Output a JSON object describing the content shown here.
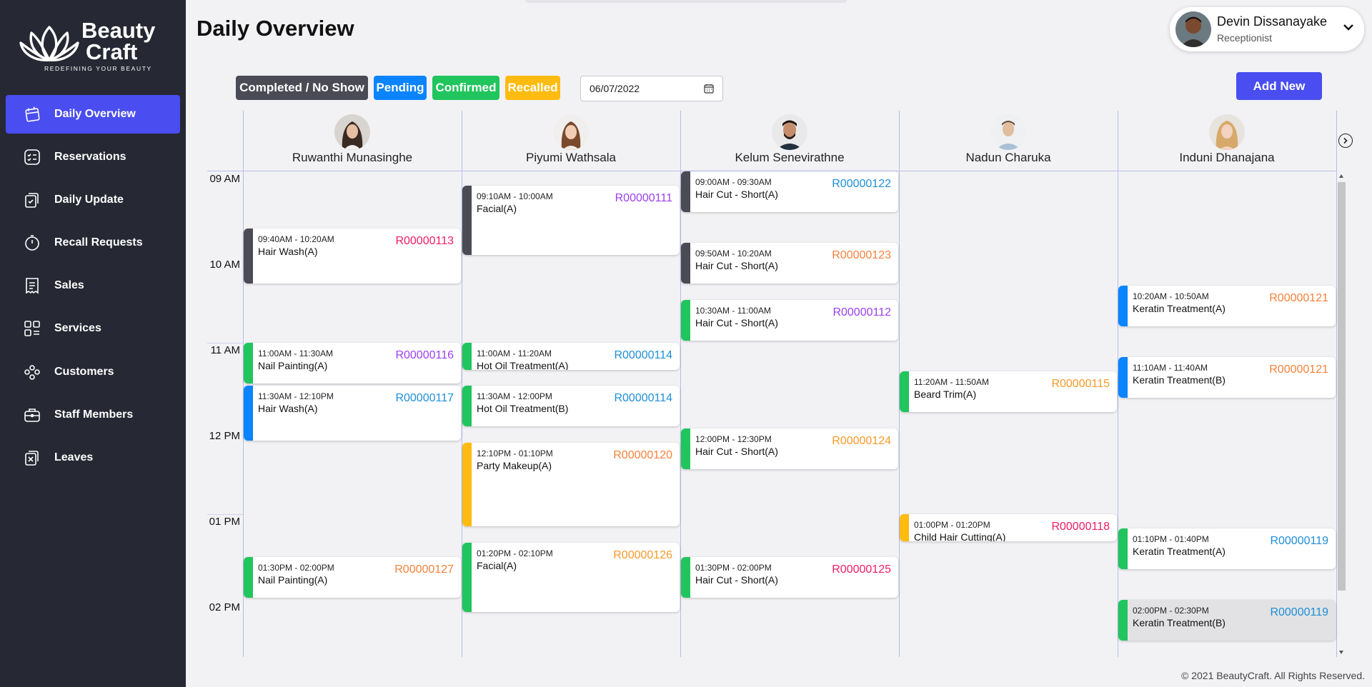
{
  "brand": {
    "name_line1": "Beauty",
    "name_line2": "Craft",
    "tagline": "REDEFINING YOUR BEAUTY"
  },
  "sidebar": {
    "items": [
      {
        "label": "Daily Overview",
        "icon": "calendar-icon",
        "active": true
      },
      {
        "label": "Reservations",
        "icon": "checklist-icon"
      },
      {
        "label": "Daily Update",
        "icon": "daily-update-icon"
      },
      {
        "label": "Recall Requests",
        "icon": "timer-icon"
      },
      {
        "label": "Sales",
        "icon": "receipt-icon"
      },
      {
        "label": "Services",
        "icon": "services-grid-icon"
      },
      {
        "label": "Customers",
        "icon": "customers-icon"
      },
      {
        "label": "Staff Members",
        "icon": "briefcase-icon"
      },
      {
        "label": "Leaves",
        "icon": "leave-icon"
      }
    ]
  },
  "header": {
    "title": "Daily Overview",
    "user": {
      "name": "Devin Dissanayake",
      "role": "Receptionist"
    }
  },
  "legend": [
    {
      "label": "Completed / No Show",
      "color": "#4a4b55"
    },
    {
      "label": "Pending",
      "color": "#0a84ff"
    },
    {
      "label": "Confirmed",
      "color": "#21c55d"
    },
    {
      "label": "Recalled",
      "color": "#ffbb0f"
    }
  ],
  "filters": {
    "date": "06/07/2022"
  },
  "actions": {
    "add_new": "Add New"
  },
  "calendar": {
    "staff": [
      {
        "name": "Ruwanthi Munasinghe"
      },
      {
        "name": "Piyumi Wathsala"
      },
      {
        "name": "Kelum Senevirathne"
      },
      {
        "name": "Nadun Charuka"
      },
      {
        "name": "Induni Dhanajana"
      }
    ],
    "hours": [
      "09 AM",
      "10 AM",
      "11 AM",
      "12 PM",
      "01 PM",
      "02 PM"
    ],
    "appointments": [
      {
        "staff": 0,
        "time": "09:40AM - 10:20AM",
        "service": "Hair Wash(A)",
        "code": "R00000113",
        "status": "completed",
        "code_color": "#ee1d62",
        "start_min": 40,
        "end_min": 80
      },
      {
        "staff": 0,
        "time": "11:00AM - 11:30AM",
        "service": "Nail Painting(A)",
        "code": "R00000116",
        "status": "confirmed",
        "code_color": "#9b3ff0",
        "start_min": 120,
        "end_min": 150
      },
      {
        "staff": 0,
        "time": "11:30AM - 12:10PM",
        "service": "Hair Wash(A)",
        "code": "R00000117",
        "status": "pending",
        "code_color": "#1e8fd6",
        "start_min": 150,
        "end_min": 190
      },
      {
        "staff": 0,
        "time": "01:30PM - 02:00PM",
        "service": "Nail Painting(A)",
        "code": "R00000127",
        "status": "confirmed",
        "code_color": "#f5823c",
        "start_min": 270,
        "end_min": 300
      },
      {
        "staff": 1,
        "time": "09:10AM - 10:00AM",
        "service": "Facial(A)",
        "code": "R00000111",
        "status": "completed",
        "code_color": "#9b3ff0",
        "start_min": 10,
        "end_min": 60
      },
      {
        "staff": 1,
        "time": "11:00AM - 11:20AM",
        "service": "Hot Oil Treatment(A)",
        "code": "R00000114",
        "status": "confirmed",
        "code_color": "#1e8fd6",
        "start_min": 120,
        "end_min": 140
      },
      {
        "staff": 1,
        "time": "11:30AM - 12:00PM",
        "service": "Hot Oil Treatment(B)",
        "code": "R00000114",
        "status": "confirmed",
        "code_color": "#1e8fd6",
        "start_min": 150,
        "end_min": 180
      },
      {
        "staff": 1,
        "time": "12:10PM - 01:10PM",
        "service": "Party Makeup(A)",
        "code": "R00000120",
        "status": "recalled",
        "code_color": "#f5823c",
        "start_min": 190,
        "end_min": 250
      },
      {
        "staff": 1,
        "time": "01:20PM - 02:10PM",
        "service": "Facial(A)",
        "code": "R00000126",
        "status": "confirmed",
        "code_color": "#f59a2a",
        "start_min": 260,
        "end_min": 310
      },
      {
        "staff": 2,
        "time": "09:00AM - 09:30AM",
        "service": "Hair Cut - Short(A)",
        "code": "R00000122",
        "status": "completed",
        "code_color": "#1e8fd6",
        "start_min": 0,
        "end_min": 30
      },
      {
        "staff": 2,
        "time": "09:50AM - 10:20AM",
        "service": "Hair Cut - Short(A)",
        "code": "R00000123",
        "status": "completed",
        "code_color": "#f5823c",
        "start_min": 50,
        "end_min": 80
      },
      {
        "staff": 2,
        "time": "10:30AM - 11:00AM",
        "service": "Hair Cut - Short(A)",
        "code": "R00000112",
        "status": "confirmed",
        "code_color": "#9b3ff0",
        "start_min": 90,
        "end_min": 120
      },
      {
        "staff": 2,
        "time": "12:00PM - 12:30PM",
        "service": "Hair Cut - Short(A)",
        "code": "R00000124",
        "status": "confirmed",
        "code_color": "#f59a2a",
        "start_min": 180,
        "end_min": 210
      },
      {
        "staff": 2,
        "time": "01:30PM - 02:00PM",
        "service": "Hair Cut - Short(A)",
        "code": "R00000125",
        "status": "confirmed",
        "code_color": "#ee1d62",
        "start_min": 270,
        "end_min": 300
      },
      {
        "staff": 3,
        "time": "11:20AM - 11:50AM",
        "service": "Beard Trim(A)",
        "code": "R00000115",
        "status": "confirmed",
        "code_color": "#f59a2a",
        "start_min": 140,
        "end_min": 170
      },
      {
        "staff": 3,
        "time": "01:00PM - 01:20PM",
        "service": "Child Hair Cutting(A)",
        "code": "R00000118",
        "status": "recalled",
        "code_color": "#ee1d62",
        "start_min": 240,
        "end_min": 260
      },
      {
        "staff": 4,
        "time": "10:20AM - 10:50AM",
        "service": "Keratin Treatment(A)",
        "code": "R00000121",
        "status": "pending",
        "code_color": "#f5823c",
        "start_min": 80,
        "end_min": 110
      },
      {
        "staff": 4,
        "time": "11:10AM - 11:40AM",
        "service": "Keratin Treatment(B)",
        "code": "R00000121",
        "status": "pending",
        "code_color": "#f5823c",
        "start_min": 130,
        "end_min": 160
      },
      {
        "staff": 4,
        "time": "01:10PM - 01:40PM",
        "service": "Keratin Treatment(A)",
        "code": "R00000119",
        "status": "confirmed",
        "code_color": "#1e8fd6",
        "start_min": 250,
        "end_min": 280
      },
      {
        "staff": 4,
        "time": "02:00PM - 02:30PM",
        "service": "Keratin Treatment(B)",
        "code": "R00000119",
        "status": "confirmed",
        "code_color": "#1e8fd6",
        "start_min": 300,
        "end_min": 330,
        "highlighted": true
      }
    ]
  },
  "footer": {
    "text": "© 2021 BeautyCraft. All Rights Reserved."
  }
}
